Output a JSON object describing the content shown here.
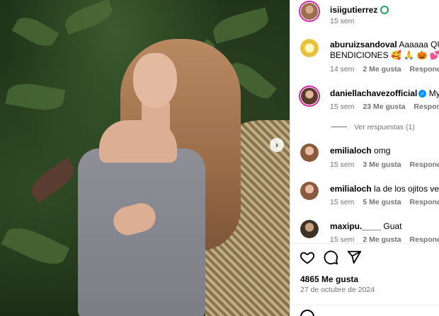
{
  "post": {
    "author": "isiigutierrez",
    "time": "15 sem"
  },
  "comments": [
    {
      "user": "aburuizsandoval",
      "text_line1": "Aaaaaa QUE B",
      "text_line2": "BENDICIONES 🥰 🙏 🎃 💕",
      "time": "14 sem",
      "likes": "2 Me gusta",
      "reply": "Responder"
    },
    {
      "user": "daniellachavezofficial",
      "text_line1": "My Do",
      "time": "15 sem",
      "likes": "23 Me gusta",
      "reply": "Responder",
      "verified": true,
      "view_replies": "Ver respuestas (1)"
    },
    {
      "user": "emilialoch",
      "text_line1": "omg",
      "time": "15 sem",
      "likes": "3 Me gusta",
      "reply": "Responder"
    },
    {
      "user": "emilialoch",
      "text_line1": "la de los ojitos verde",
      "time": "15 sem",
      "likes": "5 Me gusta",
      "reply": "Responder"
    },
    {
      "user": "maxipu.____",
      "text_line1": "Guat",
      "time": "15 sem",
      "likes": "2 Me gusta",
      "reply": "Responder"
    }
  ],
  "footer": {
    "likes": "4865 Me gusta",
    "date": "27 de octubre de 2024"
  },
  "icons": {
    "like": "heart-icon",
    "comment": "comment-icon",
    "share": "share-icon",
    "next": "chevron-right-icon"
  },
  "colors": {
    "verified": "#0095f6",
    "muted": "#737373",
    "story_ring": "#d6249f"
  }
}
